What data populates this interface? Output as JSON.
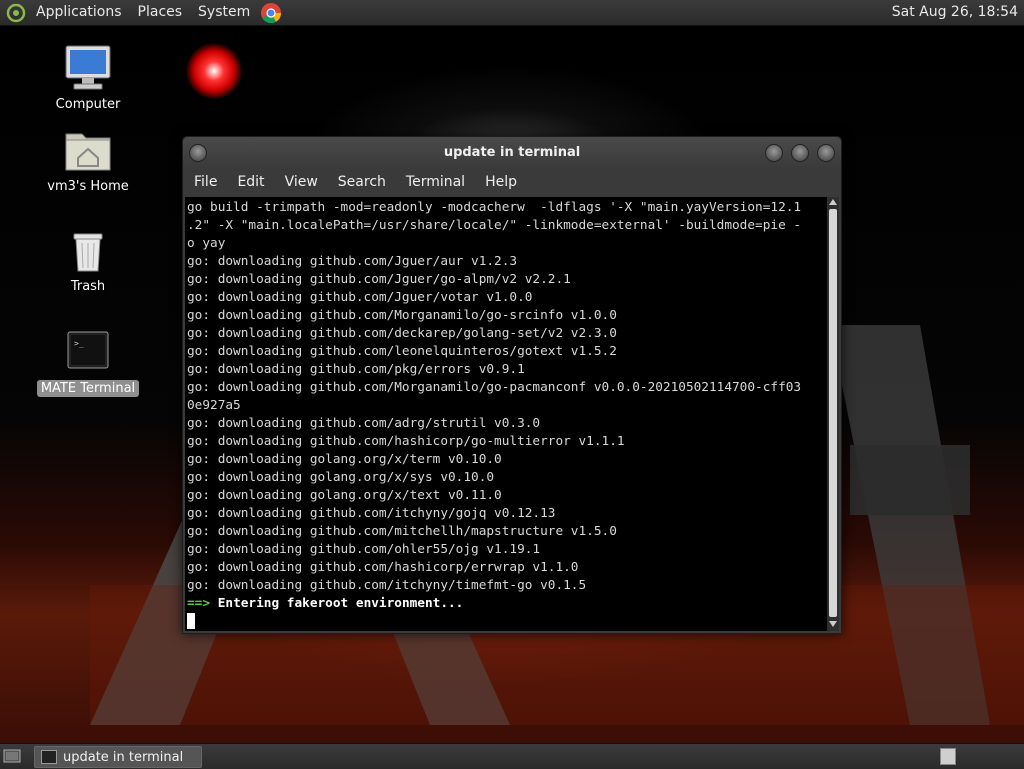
{
  "top_panel": {
    "menus": [
      "Applications",
      "Places",
      "System"
    ],
    "clock": "Sat Aug 26, 18:54"
  },
  "desktop": {
    "icons": [
      {
        "label": "Computer",
        "icon": "computer-icon"
      },
      {
        "label": "vm3's Home",
        "icon": "home-folder-icon"
      },
      {
        "label": "Trash",
        "icon": "trash-icon"
      },
      {
        "label": "MATE Terminal",
        "icon": "terminal-icon",
        "selected": true
      }
    ]
  },
  "terminal": {
    "title": "update in terminal",
    "menus": [
      "File",
      "Edit",
      "View",
      "Search",
      "Terminal",
      "Help"
    ],
    "lines": [
      "go build -trimpath -mod=readonly -modcacherw  -ldflags '-X \"main.yayVersion=12.1",
      ".2\" -X \"main.localePath=/usr/share/locale/\" -linkmode=external' -buildmode=pie -",
      "o yay",
      "go: downloading github.com/Jguer/aur v1.2.3",
      "go: downloading github.com/Jguer/go-alpm/v2 v2.2.1",
      "go: downloading github.com/Jguer/votar v1.0.0",
      "go: downloading github.com/Morganamilo/go-srcinfo v1.0.0",
      "go: downloading github.com/deckarep/golang-set/v2 v2.3.0",
      "go: downloading github.com/leonelquinteros/gotext v1.5.2",
      "go: downloading github.com/pkg/errors v0.9.1",
      "go: downloading github.com/Morganamilo/go-pacmanconf v0.0.0-20210502114700-cff03",
      "0e927a5",
      "go: downloading github.com/adrg/strutil v0.3.0",
      "go: downloading github.com/hashicorp/go-multierror v1.1.1",
      "go: downloading golang.org/x/term v0.10.0",
      "go: downloading golang.org/x/sys v0.10.0",
      "go: downloading golang.org/x/text v0.11.0",
      "go: downloading github.com/itchyny/gojq v0.12.13",
      "go: downloading github.com/mitchellh/mapstructure v1.5.0",
      "go: downloading github.com/ohler55/ojg v1.19.1",
      "go: downloading github.com/hashicorp/errwrap v1.1.0",
      "go: downloading github.com/itchyny/timefmt-go v0.1.5"
    ],
    "status_arrow": "==>",
    "status_text": "Entering fakeroot environment..."
  },
  "bottom_panel": {
    "task_label": "update in terminal"
  },
  "colors": {
    "prompt_arrow": "#4fd13a",
    "terminal_bg": "#000000",
    "panel_bg": "#2e2e2e"
  }
}
